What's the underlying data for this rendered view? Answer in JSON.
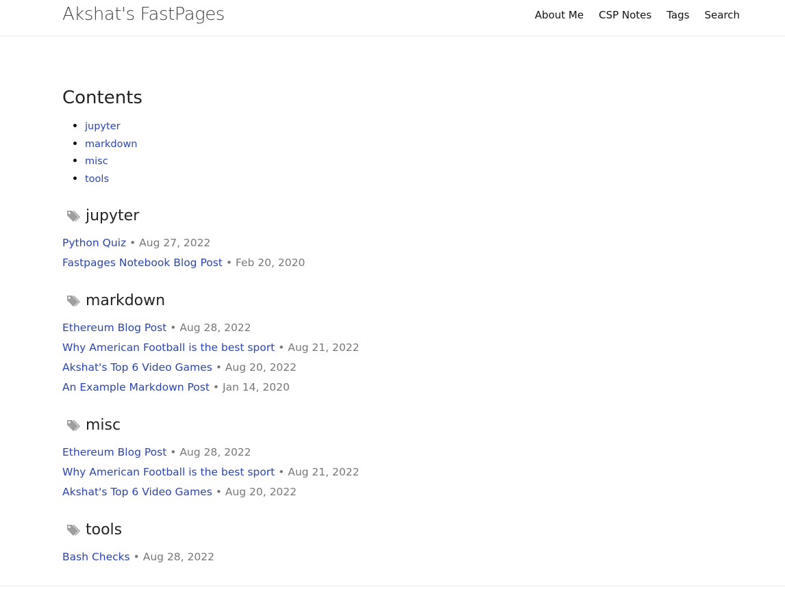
{
  "header": {
    "site_title": "Akshat's FastPages",
    "nav": [
      {
        "label": "About Me"
      },
      {
        "label": "CSP Notes"
      },
      {
        "label": "Tags"
      },
      {
        "label": "Search"
      }
    ]
  },
  "contents": {
    "title": "Contents",
    "items": [
      "jupyter",
      "markdown",
      "misc",
      "tools"
    ]
  },
  "separator": "•",
  "icon_color": "#9e9e9e",
  "link_color": "#2a45b0",
  "sections": [
    {
      "tag": "jupyter",
      "icon": "tags-icon",
      "posts": [
        {
          "title": "Python Quiz",
          "date": "Aug 27, 2022"
        },
        {
          "title": "Fastpages Notebook Blog Post",
          "date": "Feb 20, 2020"
        }
      ]
    },
    {
      "tag": "markdown",
      "icon": "tags-icon",
      "posts": [
        {
          "title": "Ethereum Blog Post",
          "date": "Aug 28, 2022"
        },
        {
          "title": "Why American Football is the best sport",
          "date": "Aug 21, 2022"
        },
        {
          "title": "Akshat's Top 6 Video Games",
          "date": "Aug 20, 2022"
        },
        {
          "title": "An Example Markdown Post",
          "date": "Jan 14, 2020"
        }
      ]
    },
    {
      "tag": "misc",
      "icon": "tags-icon",
      "posts": [
        {
          "title": "Ethereum Blog Post",
          "date": "Aug 28, 2022"
        },
        {
          "title": "Why American Football is the best sport",
          "date": "Aug 21, 2022"
        },
        {
          "title": "Akshat's Top 6 Video Games",
          "date": "Aug 20, 2022"
        }
      ]
    },
    {
      "tag": "tools",
      "icon": "tags-icon",
      "posts": [
        {
          "title": "Bash Checks",
          "date": "Aug 28, 2022"
        }
      ]
    }
  ]
}
